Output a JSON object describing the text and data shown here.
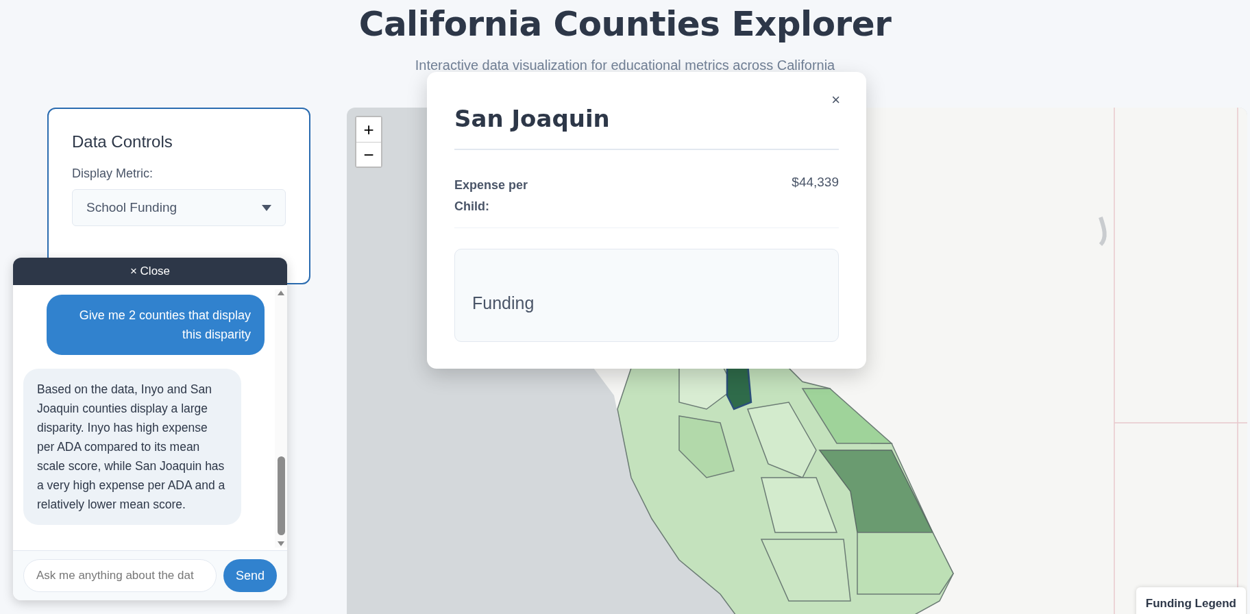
{
  "header": {
    "title": "California Counties Explorer",
    "subtitle": "Interactive data visualization for educational metrics across California"
  },
  "controls": {
    "title": "Data Controls",
    "metric_label": "Display Metric:",
    "metric_value": "School Funding"
  },
  "map": {
    "kind": "picture",
    "zoom_in": "+",
    "zoom_out": "−",
    "legend_title": "Funding Legend"
  },
  "popup": {
    "close": "×",
    "county": "San Joaquin",
    "stat_label": "Expense per Child:",
    "stat_value": "$44,339",
    "section_title": "Funding"
  },
  "chat": {
    "close": "× Close",
    "messages": [
      {
        "kind": "user",
        "text": "Give me 2 counties that display this disparity"
      },
      {
        "kind": "assistant",
        "text": "Based on the data, Inyo and San Joaquin counties display a large disparity. Inyo has high expense per ADA compared to its mean scale score, while San Joaquin has a very high expense per ADA and a relatively lower mean score."
      }
    ],
    "placeholder": "Ask me anything about the dat",
    "send": "Send"
  }
}
